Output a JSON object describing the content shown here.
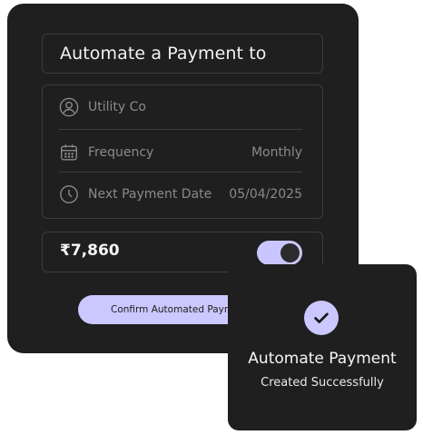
{
  "payment_form": {
    "title": "Automate a Payment to",
    "payee": {
      "label": "Utility Co",
      "icon": "user-circle-icon"
    },
    "frequency": {
      "label": "Frequency",
      "value": "Monthly",
      "icon": "calendar-icon"
    },
    "next_payment": {
      "label": "Next Payment Date",
      "value": "05/04/2025",
      "icon": "clock-icon"
    },
    "amount": "₹7,860",
    "auto_toggle": {
      "state": "on",
      "color": "#c9c6ff"
    },
    "confirm_button_label": "Confirm Automated Payment"
  },
  "success_dialog": {
    "icon": "check-circle-icon",
    "title": "Automate Payment",
    "subtitle": "Created Successfully"
  },
  "colors": {
    "card_bg": "#1f1f1f",
    "accent": "#cbc8ff",
    "border": "#3d3d3d",
    "muted_text": "#8a8a8a"
  }
}
